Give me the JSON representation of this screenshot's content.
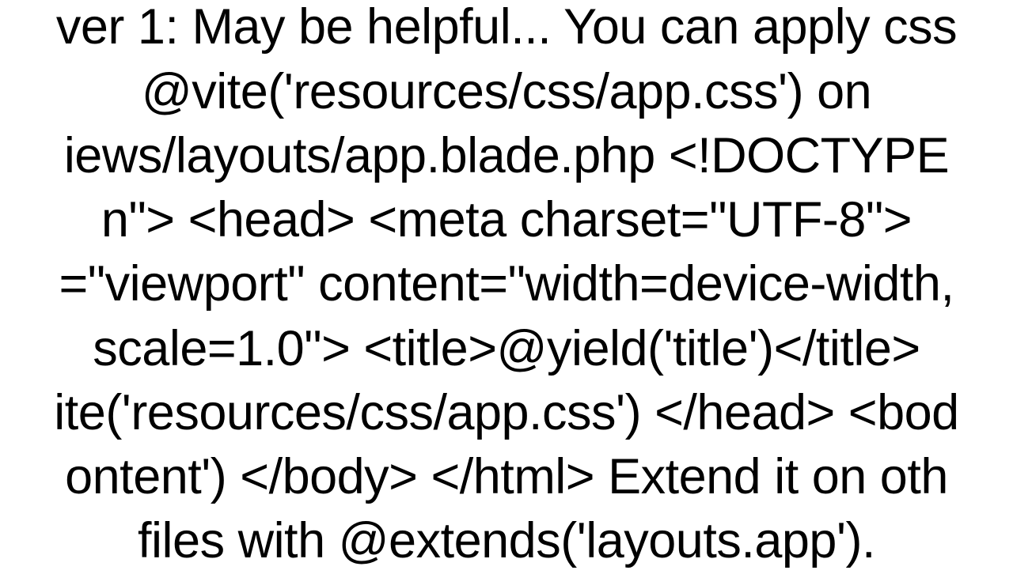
{
  "lines": [
    "ver 1: May be helpful... You can apply css",
    "@vite('resources/css/app.css') on",
    "iews/layouts/app.blade.php <!DOCTYPE",
    "n\"> <head>     <meta charset=\"UTF-8\">",
    "=\"viewport\" content=\"width=device-width,",
    "scale=1.0\">     <title>@yield('title')</title>",
    "ite('resources/css/app.css') </head> <bod",
    "ontent') </body> </html>  Extend it on oth",
    "files with @extends('layouts.app')."
  ]
}
